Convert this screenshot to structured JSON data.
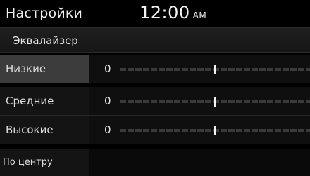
{
  "header": {
    "title": "Настройки",
    "time": "12:00",
    "ampm": "AM"
  },
  "subheader": {
    "title": "Эквалайзер"
  },
  "bands": [
    {
      "label": "Низкие",
      "value": "0",
      "level": 0.5,
      "selected": true
    },
    {
      "label": "Средние",
      "value": "0",
      "level": 0.5,
      "selected": false
    },
    {
      "label": "Высокие",
      "value": "0",
      "level": 0.5,
      "selected": false
    }
  ],
  "center_button": {
    "label": "По центру"
  },
  "colors": {
    "background": "#000000",
    "selected_row": "#3c3c3c",
    "track": "#3a3a3a",
    "thumb": "#f4f4f4"
  }
}
